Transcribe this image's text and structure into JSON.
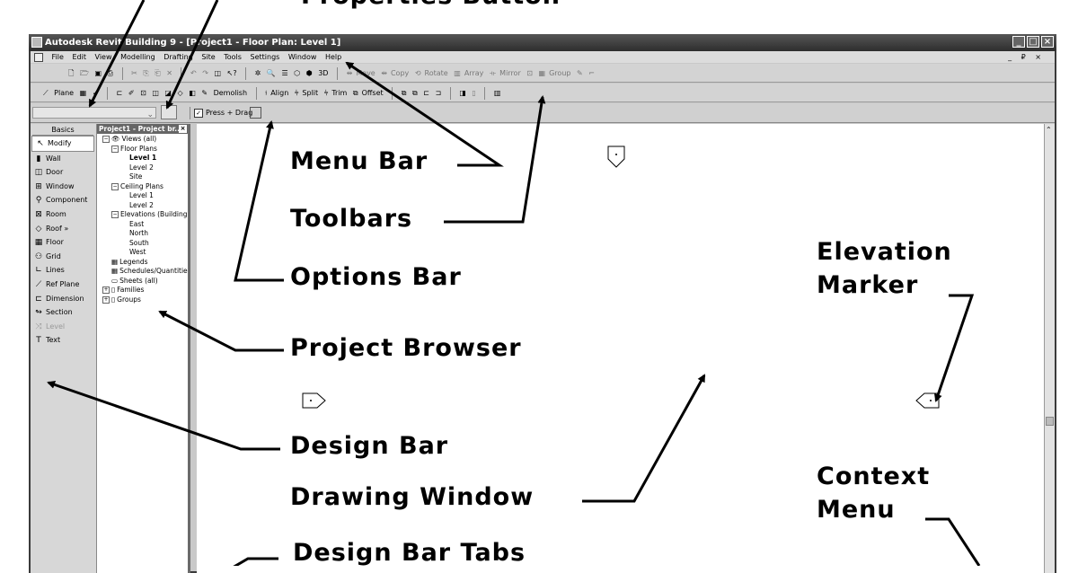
{
  "annotation_top": "Properties Button",
  "window": {
    "title": "Autodesk Revit Building 9 - [Project1 - Floor Plan: Level 1]",
    "controls": [
      "_",
      "□",
      "×"
    ]
  },
  "menu": {
    "items": [
      "File",
      "Edit",
      "View",
      "Modelling",
      "Drafting",
      "Site",
      "Tools",
      "Settings",
      "Window",
      "Help"
    ],
    "mdi_controls": "_ ₽ ×"
  },
  "toolbar1": {
    "edit_tools": [
      "Move",
      "Copy",
      "Rotate",
      "Array",
      "Mirror",
      "Group"
    ],
    "three_d": "3D"
  },
  "toolbar2": {
    "work_plane": "Plane",
    "demolish": "Demolish",
    "align": "Align",
    "split": "Split",
    "trim": "Trim",
    "offset": "Offset"
  },
  "options_bar": {
    "press_drag": "Press + Drag"
  },
  "design_bar": {
    "tab": "Basics",
    "items": [
      {
        "label": "Modify",
        "icon": "cursor-icon",
        "glyph": "↖"
      },
      {
        "label": "Wall",
        "icon": "wall-icon",
        "glyph": "▮"
      },
      {
        "label": "Door",
        "icon": "door-icon",
        "glyph": "◫"
      },
      {
        "label": "Window",
        "icon": "window-icon",
        "glyph": "⊞"
      },
      {
        "label": "Component",
        "icon": "component-icon",
        "glyph": "⚲"
      },
      {
        "label": "Room",
        "icon": "room-icon",
        "glyph": "⊠"
      },
      {
        "label": "Roof »",
        "icon": "roof-icon",
        "glyph": "◇"
      },
      {
        "label": "Floor",
        "icon": "floor-icon",
        "glyph": "▦"
      },
      {
        "label": "Grid",
        "icon": "grid-icon",
        "glyph": "⚇"
      },
      {
        "label": "Lines",
        "icon": "lines-icon",
        "glyph": "∟"
      },
      {
        "label": "Ref Plane",
        "icon": "ref-plane-icon",
        "glyph": "⟋"
      },
      {
        "label": "Dimension",
        "icon": "dimension-icon",
        "glyph": "⊏"
      },
      {
        "label": "Section",
        "icon": "section-icon",
        "glyph": "↬"
      },
      {
        "label": "Level",
        "icon": "level-icon",
        "glyph": "⤨"
      },
      {
        "label": "Text",
        "icon": "text-icon",
        "glyph": "T"
      }
    ]
  },
  "project_browser": {
    "title": "Project1 - Project br...",
    "tree": [
      {
        "label": "Views (all)",
        "depth": 0,
        "expander": "−",
        "icon": "👁"
      },
      {
        "label": "Floor Plans",
        "depth": 1,
        "expander": "−"
      },
      {
        "label": "Level 1",
        "depth": 2,
        "bold": true
      },
      {
        "label": "Level 2",
        "depth": 2
      },
      {
        "label": "Site",
        "depth": 2
      },
      {
        "label": "Ceiling Plans",
        "depth": 1,
        "expander": "−"
      },
      {
        "label": "Level 1",
        "depth": 2
      },
      {
        "label": "Level 2",
        "depth": 2
      },
      {
        "label": "Elevations (Building",
        "depth": 1,
        "expander": "−"
      },
      {
        "label": "East",
        "depth": 2
      },
      {
        "label": "North",
        "depth": 2
      },
      {
        "label": "South",
        "depth": 2
      },
      {
        "label": "West",
        "depth": 2
      },
      {
        "label": "Legends",
        "depth": 1,
        "icon": "▦"
      },
      {
        "label": "Schedules/Quantitie",
        "depth": 1,
        "icon": "▦"
      },
      {
        "label": "Sheets (all)",
        "depth": 1,
        "icon": "▭"
      },
      {
        "label": "Families",
        "depth": 0,
        "expander": "+",
        "icon": "▯"
      },
      {
        "label": "Groups",
        "depth": 0,
        "expander": "+",
        "icon": "▯"
      }
    ]
  },
  "callouts": {
    "menu_bar": "Menu Bar",
    "toolbars": "Toolbars",
    "options_bar": "Options Bar",
    "project_browser": "Project Browser",
    "design_bar": "Design Bar",
    "drawing_window": "Drawing Window",
    "design_bar_tabs": "Design Bar Tabs",
    "elevation_marker": "Elevation\nMarker",
    "elevation_marker_1": "Elevation",
    "elevation_marker_2": "Marker",
    "context_menu_1": "Context",
    "context_menu_2": "Menu"
  }
}
